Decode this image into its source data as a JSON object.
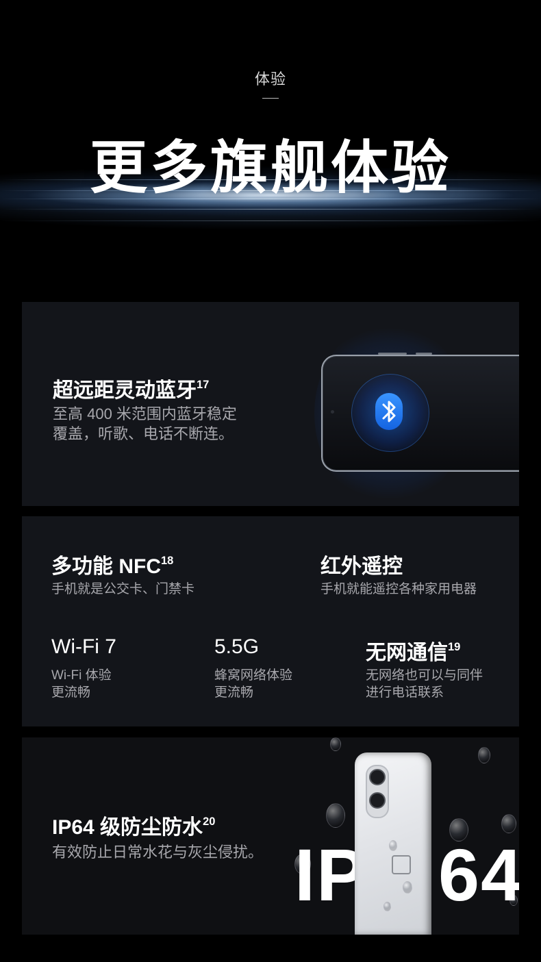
{
  "hero": {
    "eyebrow": "体验",
    "title": "更多旗舰体验"
  },
  "bluetooth": {
    "title": "超远距灵动蓝牙",
    "footnote": "17",
    "desc_line1": "至高 400 米范围内蓝牙稳定",
    "desc_line2": "覆盖，听歌、电话不断连。",
    "icon": "bluetooth-icon",
    "accent": "#1f7bff"
  },
  "features": {
    "nfc": {
      "title": "多功能 NFC",
      "footnote": "18",
      "desc": "手机就是公交卡、门禁卡"
    },
    "ir": {
      "title": "红外遥控",
      "desc": "手机就能遥控各种家用电器"
    },
    "wifi": {
      "title": "Wi-Fi 7",
      "desc_line1": "Wi-Fi 体验",
      "desc_line2": "更流畅"
    },
    "g55": {
      "title": "5.5G",
      "desc_line1": "蜂窝网络体验",
      "desc_line2": "更流畅"
    },
    "nonetwork": {
      "title": "无网通信",
      "footnote": "19",
      "desc_line1": "无网络也可以与同伴",
      "desc_line2": "进行电话联系"
    }
  },
  "ip64": {
    "title": "IP64 级防尘防水",
    "footnote": "20",
    "desc": "有效防止日常水花与灰尘侵扰。",
    "big_left": "IP",
    "big_right": "64"
  }
}
